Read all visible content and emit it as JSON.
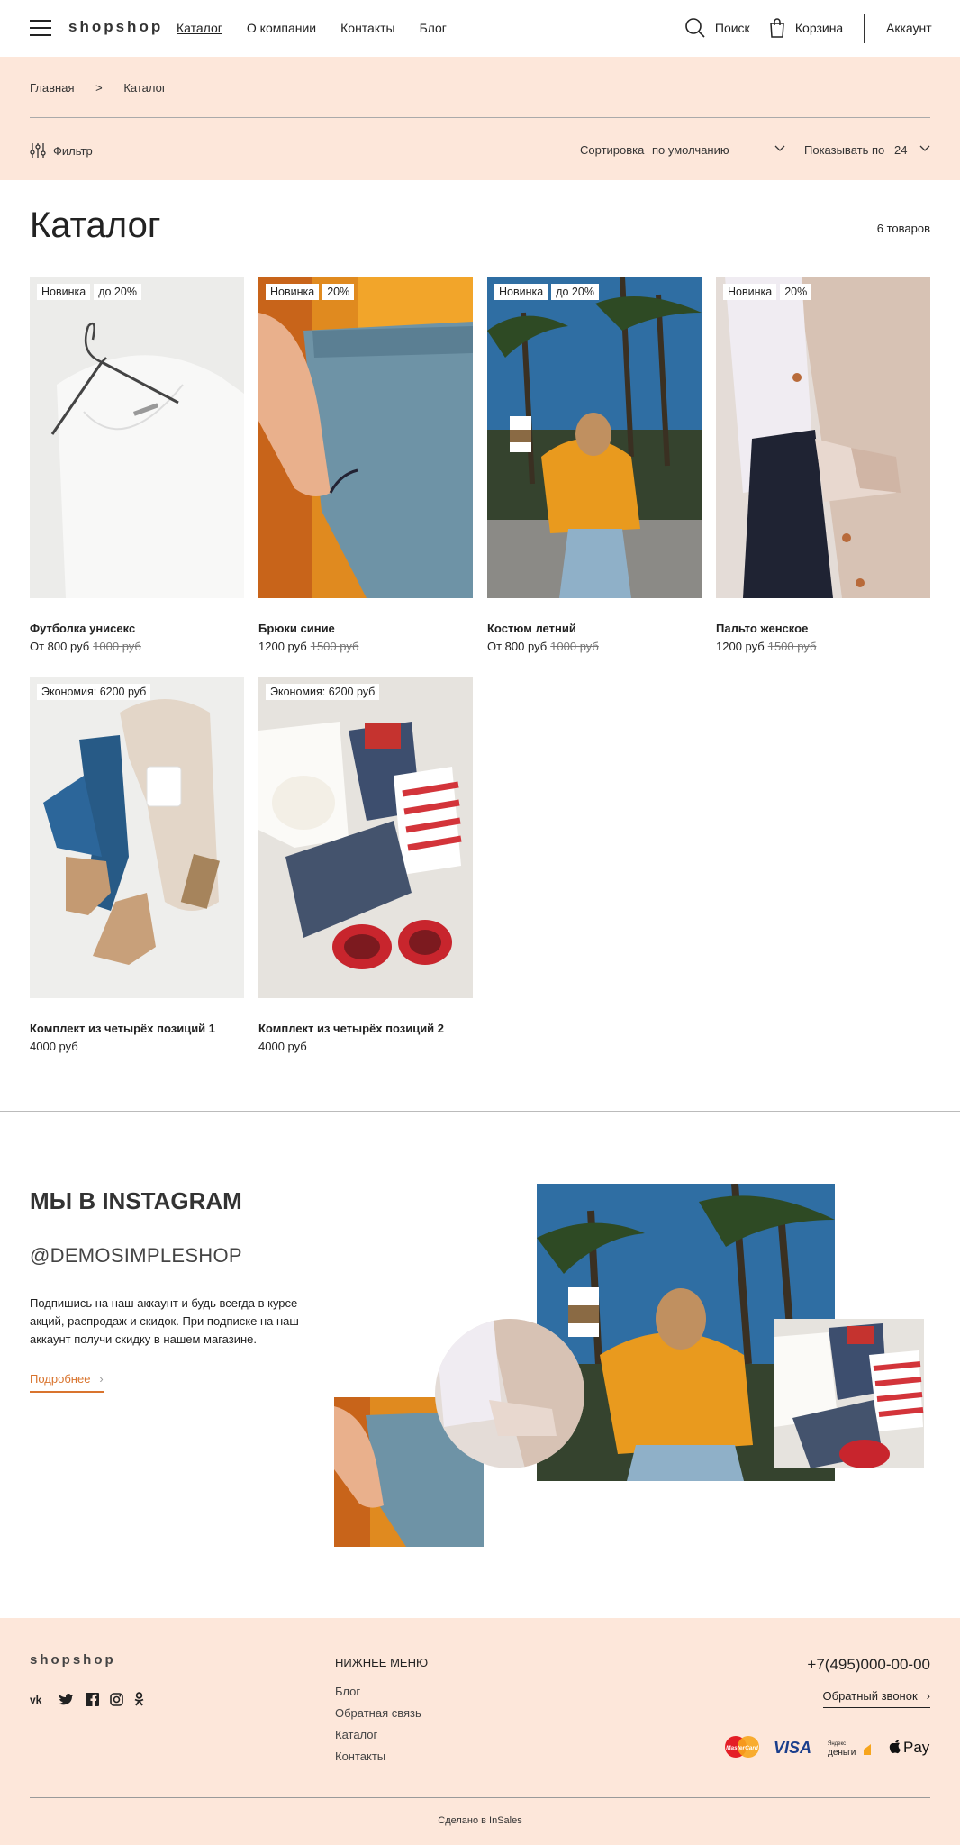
{
  "header": {
    "logo": "shopshop",
    "nav": [
      "Каталог",
      "О компании",
      "Контакты",
      "Блог"
    ],
    "search_label": "Поиск",
    "cart_label": "Корзина",
    "account_label": "Аккаунт"
  },
  "breadcrumb": {
    "home": "Главная",
    "sep": ">",
    "current": "Каталог"
  },
  "toolbar": {
    "filter_label": "Фильтр",
    "sort_label": "Сортировка",
    "sort_value": "по умолчанию",
    "per_page_label": "Показывать по",
    "per_page_value": "24"
  },
  "catalog": {
    "title": "Каталог",
    "count": "6 товаров",
    "products": [
      {
        "name": "Футболка унисекс",
        "price": "От 800 руб",
        "old_price": "1000 руб",
        "badges": [
          "Новинка",
          "до 20%"
        ]
      },
      {
        "name": "Брюки синие",
        "price": "1200 руб",
        "old_price": "1500 руб",
        "badges": [
          "Новинка",
          "20%"
        ]
      },
      {
        "name": "Костюм летний",
        "price": "От 800 руб",
        "old_price": "1000 руб",
        "badges": [
          "Новинка",
          "до 20%"
        ]
      },
      {
        "name": "Пальто женское",
        "price": "1200 руб",
        "old_price": "1500 руб",
        "badges": [
          "Новинка",
          "20%"
        ]
      },
      {
        "name": "Комплект из четырёх позиций 1",
        "price": "4000 руб",
        "old_price": "",
        "badges": [
          "Экономия: 6200 руб"
        ]
      },
      {
        "name": "Комплект из четырёх позиций 2",
        "price": "4000 руб",
        "old_price": "",
        "badges": [
          "Экономия: 6200 руб"
        ]
      }
    ]
  },
  "instagram": {
    "title": "МЫ В INSTAGRAM",
    "handle": "@DEMOSIMPLESHOP",
    "text": "Подпишись на наш аккаунт и будь всегда в курсе акций, распродаж и скидок. При подписке на наш аккаунт получи скидку в нашем магазине.",
    "more": "Подробнее"
  },
  "footer": {
    "logo": "shopshop",
    "menu_title": "НИЖНЕЕ МЕНЮ",
    "menu": [
      "Блог",
      "Обратная связь",
      "Каталог",
      "Контакты"
    ],
    "phone": "+7(495)000-00-00",
    "callback": "Обратный звонок",
    "pay": [
      "MasterCard",
      "VISA",
      "Яндекс Деньги",
      "Pay"
    ],
    "made": "Сделано в InSales"
  },
  "colors": {
    "accent": "#d9742e",
    "peach": "#fde7da"
  }
}
